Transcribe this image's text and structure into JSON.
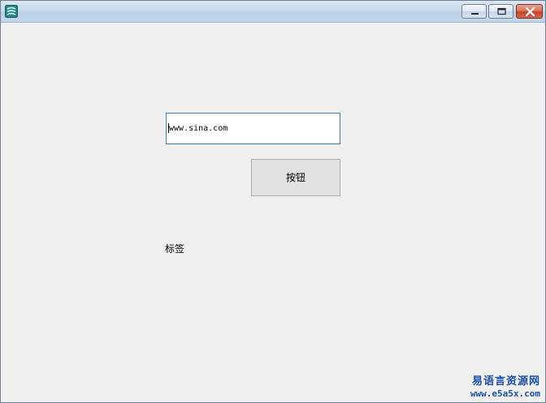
{
  "window": {
    "title": "",
    "icon": "app-icon",
    "controls": {
      "minimize_icon": "minimize-icon",
      "maximize_icon": "maximize-icon",
      "close_icon": "close-icon",
      "close_color": "#c3452b"
    }
  },
  "form": {
    "url_input": {
      "value": "www.sina.com"
    },
    "button": {
      "label": "按钮"
    },
    "label": {
      "text": "标签"
    }
  },
  "watermark": {
    "title": "易语言资源网",
    "url": "www.e5a5x.com",
    "color": "#1a4ea8"
  }
}
